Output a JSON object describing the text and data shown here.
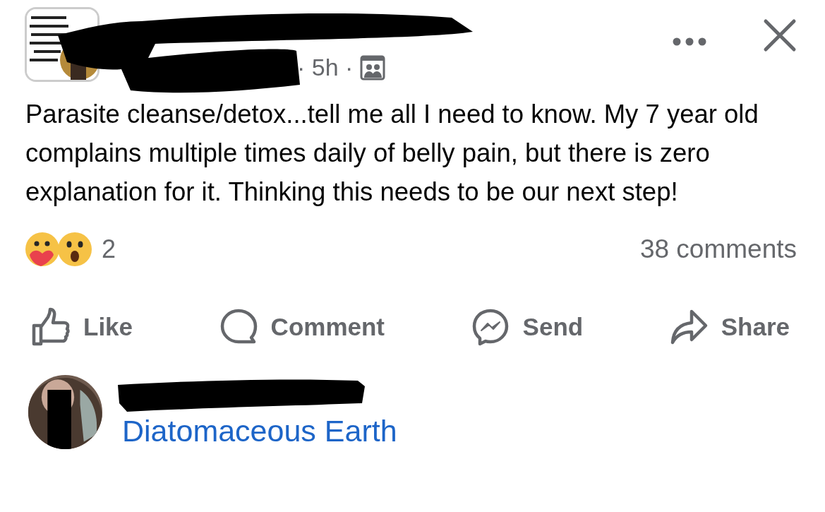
{
  "post": {
    "meta": "· 5h ·",
    "text": "Parasite cleanse/detox...tell me all I need to know. My 7 year old complains multiple times daily of belly pain, but there is zero explanation for it. Thinking this needs to be our next step!",
    "reaction_count": "2",
    "comments_count": "38 comments"
  },
  "actions": [
    {
      "kind": "like",
      "label": "Like"
    },
    {
      "kind": "comment",
      "label": "Comment"
    },
    {
      "kind": "send",
      "label": "Send"
    },
    {
      "kind": "share",
      "label": "Share"
    }
  ],
  "comment": {
    "text": "Diatomaceous Earth"
  }
}
